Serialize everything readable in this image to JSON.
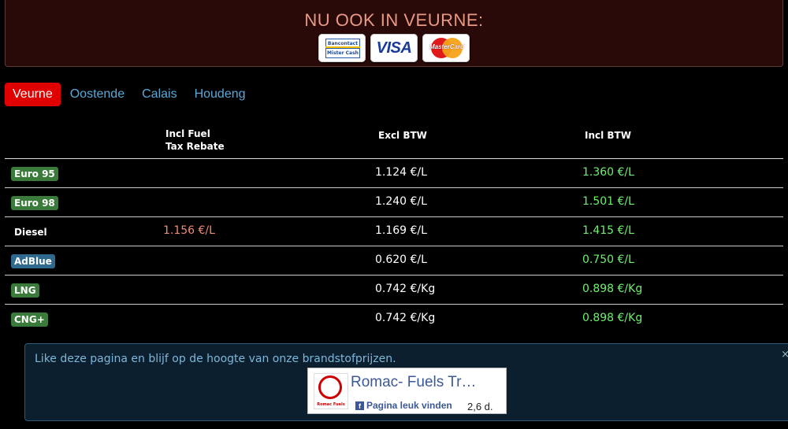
{
  "promo": {
    "title": "NU OOK IN VEURNE:",
    "cards": [
      {
        "name": "Bancontact",
        "top": "Bancontact",
        "bottom": "Mister Cash"
      },
      {
        "name": "VISA",
        "label": "VISA"
      },
      {
        "name": "MasterCard",
        "label": "MasterCard"
      }
    ]
  },
  "tabs": [
    "Veurne",
    "Oostende",
    "Calais",
    "Houdeng"
  ],
  "active_tab": "Veurne",
  "table": {
    "headers": {
      "rebate_line1": "Incl Fuel",
      "rebate_line2": "Tax Rebate",
      "excl": "Excl BTW",
      "incl": "Incl BTW"
    },
    "rows": [
      {
        "fuel": "Euro 95",
        "badge_color": "#3a7a3a",
        "rebate": "",
        "excl": "1.124 €/L",
        "incl": "1.360 €/L"
      },
      {
        "fuel": "Euro 98",
        "badge_color": "#3a7a3a",
        "rebate": "",
        "excl": "1.240 €/L",
        "incl": "1.501 €/L"
      },
      {
        "fuel": "Diesel",
        "badge_color": "",
        "rebate": "1.156 €/L",
        "excl": "1.169 €/L",
        "incl": "1.415 €/L"
      },
      {
        "fuel": "AdBlue",
        "badge_color": "#2f6a8e",
        "rebate": "",
        "excl": "0.620 €/L",
        "incl": "0.750 €/L"
      },
      {
        "fuel": "LNG",
        "badge_color": "#3a7a3a",
        "rebate": "",
        "excl": "0.742 €/Kg",
        "incl": "0.898 €/Kg"
      },
      {
        "fuel": "CNG+",
        "badge_color": "#3a7a3a",
        "rebate": "",
        "excl": "0.742 €/Kg",
        "incl": "0.898 €/Kg"
      }
    ]
  },
  "facebook": {
    "message": "Like deze pagina en blijf op de hoogte van onze brandstofprijzen.",
    "close": "×",
    "page_name": "Romac- Fuels Tr…",
    "like_label": "Pagina leuk vinden",
    "like_count": "2,6 d.",
    "logo_text": "Romac Fuels"
  },
  "colors": {
    "active_tab": "#e00000",
    "tab_link": "#5aa8d8",
    "incl_price": "#6ef06e",
    "rebate_price": "#f08a74",
    "promo_bg": "#2a0a08"
  }
}
